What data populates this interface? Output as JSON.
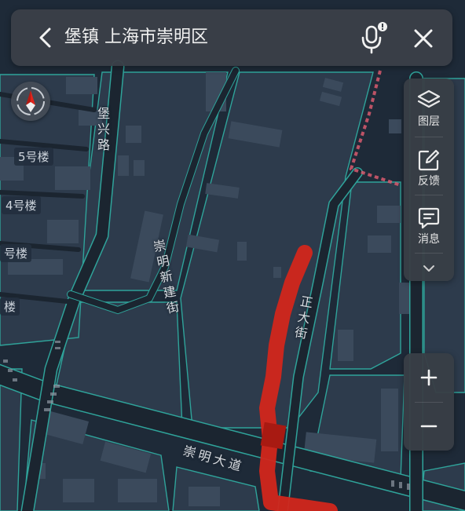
{
  "search": {
    "query": "堡镇 上海市崇明区"
  },
  "side_panel": {
    "layers_label": "图层",
    "feedback_label": "反馈",
    "message_label": "消息"
  },
  "map": {
    "labels": {
      "baoxing_road": "堡兴路",
      "chongming_xinjian_street": "崇明新建街",
      "zhengda_street": "正大街",
      "chongming_avenue": "崇明大道",
      "building_5": "5号楼",
      "building_4": "4号楼",
      "building_3": "号楼",
      "building_2": "楼"
    }
  },
  "colors": {
    "route": "#d2261b",
    "road_edge": "#2fa39a",
    "block": "#2d3b4c",
    "background": "#1e2a38"
  },
  "icons": [
    "back-icon",
    "microphone-icon",
    "close-icon",
    "compass-icon",
    "layers-icon",
    "feedback-icon",
    "message-icon",
    "chevron-down-icon",
    "zoom-in-icon",
    "zoom-out-icon"
  ]
}
